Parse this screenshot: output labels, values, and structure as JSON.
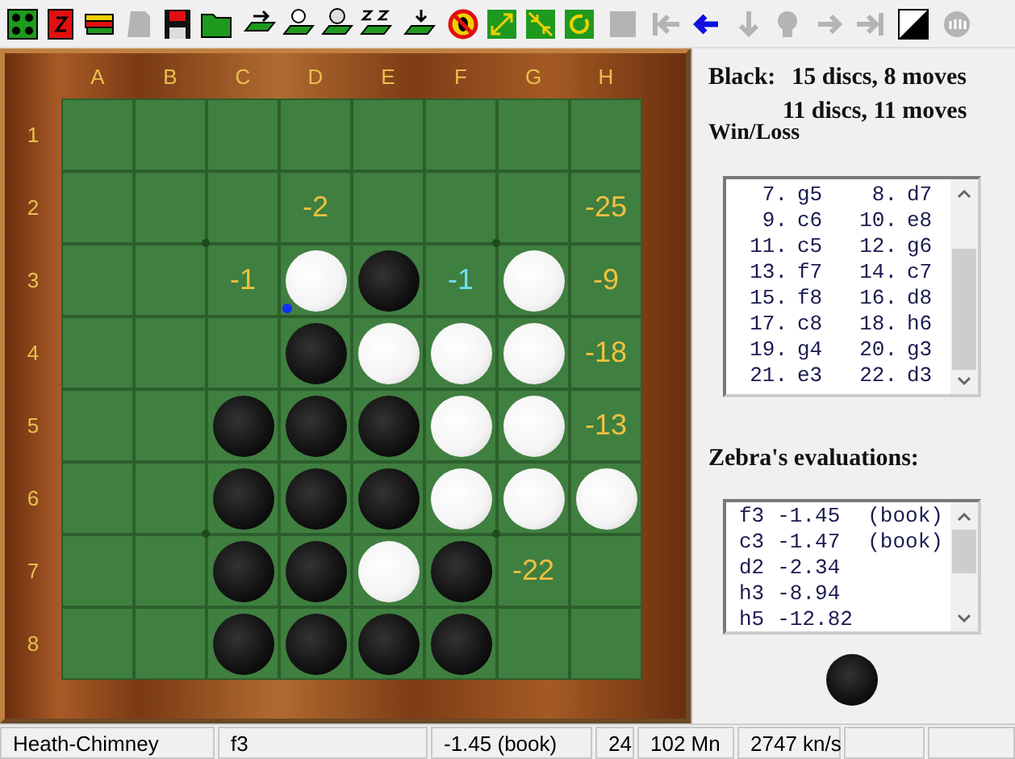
{
  "toolbar": [
    [
      {
        "kind": "dice",
        "disabled": false
      },
      {
        "kind": "book",
        "disabled": false
      },
      {
        "kind": "books",
        "disabled": false
      },
      {
        "kind": "page",
        "disabled": true
      },
      {
        "kind": "floppy",
        "disabled": false
      },
      {
        "kind": "folder",
        "disabled": false
      }
    ],
    [
      {
        "kind": "board-arrow",
        "disabled": false
      },
      {
        "kind": "board-person",
        "disabled": false
      },
      {
        "kind": "board-face",
        "disabled": false
      },
      {
        "kind": "board-zz",
        "disabled": false
      }
    ],
    [
      {
        "kind": "board-down",
        "disabled": false
      }
    ],
    [
      {
        "kind": "no-sign",
        "disabled": false
      },
      {
        "kind": "expand",
        "disabled": false
      },
      {
        "kind": "contract",
        "disabled": false
      },
      {
        "kind": "rotate",
        "disabled": false
      }
    ],
    [
      {
        "kind": "square",
        "disabled": true
      }
    ],
    [
      {
        "kind": "first",
        "disabled": true
      },
      {
        "kind": "back",
        "disabled": false
      }
    ],
    [
      {
        "kind": "down",
        "disabled": true
      },
      {
        "kind": "bulb",
        "disabled": true
      }
    ],
    [
      {
        "kind": "forward",
        "disabled": true
      },
      {
        "kind": "last",
        "disabled": true
      }
    ],
    [
      {
        "kind": "contrast",
        "disabled": false
      }
    ],
    [
      {
        "kind": "stop",
        "disabled": true
      }
    ]
  ],
  "board": {
    "columns": [
      "A",
      "B",
      "C",
      "D",
      "E",
      "F",
      "G",
      "H"
    ],
    "row_labels": [
      "1",
      "2",
      "3",
      "4",
      "5",
      "6",
      "7",
      "8"
    ],
    "rows": [
      [
        {
          "kind": "empty"
        },
        {
          "kind": "empty"
        },
        {
          "kind": "empty"
        },
        {
          "kind": "empty"
        },
        {
          "kind": "empty"
        },
        {
          "kind": "empty"
        },
        {
          "kind": "empty"
        },
        {
          "kind": "empty"
        }
      ],
      [
        {
          "kind": "empty"
        },
        {
          "kind": "empty"
        },
        {
          "kind": "empty"
        },
        {
          "kind": "hint",
          "eval": "-2",
          "best": false
        },
        {
          "kind": "empty"
        },
        {
          "kind": "empty"
        },
        {
          "kind": "empty"
        },
        {
          "kind": "hint",
          "eval": "-25",
          "best": false
        }
      ],
      [
        {
          "kind": "empty"
        },
        {
          "kind": "empty"
        },
        {
          "kind": "hint",
          "eval": "-1",
          "best": false
        },
        {
          "kind": "white",
          "last_move": true
        },
        {
          "kind": "black",
          "last_move": false
        },
        {
          "kind": "hint",
          "eval": "-1",
          "best": true
        },
        {
          "kind": "white",
          "last_move": false
        },
        {
          "kind": "hint",
          "eval": "-9",
          "best": false
        }
      ],
      [
        {
          "kind": "empty"
        },
        {
          "kind": "empty"
        },
        {
          "kind": "empty"
        },
        {
          "kind": "black",
          "last_move": false
        },
        {
          "kind": "white",
          "last_move": false
        },
        {
          "kind": "white",
          "last_move": false
        },
        {
          "kind": "white",
          "last_move": false
        },
        {
          "kind": "hint",
          "eval": "-18",
          "best": false
        }
      ],
      [
        {
          "kind": "empty"
        },
        {
          "kind": "empty"
        },
        {
          "kind": "black",
          "last_move": false
        },
        {
          "kind": "black",
          "last_move": false
        },
        {
          "kind": "black",
          "last_move": false
        },
        {
          "kind": "white",
          "last_move": false
        },
        {
          "kind": "white",
          "last_move": false
        },
        {
          "kind": "hint",
          "eval": "-13",
          "best": false
        }
      ],
      [
        {
          "kind": "empty"
        },
        {
          "kind": "empty"
        },
        {
          "kind": "black",
          "last_move": false
        },
        {
          "kind": "black",
          "last_move": false
        },
        {
          "kind": "black",
          "last_move": false
        },
        {
          "kind": "white",
          "last_move": false
        },
        {
          "kind": "white",
          "last_move": false
        },
        {
          "kind": "white",
          "last_move": false
        }
      ],
      [
        {
          "kind": "empty"
        },
        {
          "kind": "empty"
        },
        {
          "kind": "black",
          "last_move": false
        },
        {
          "kind": "black",
          "last_move": false
        },
        {
          "kind": "white",
          "last_move": false
        },
        {
          "kind": "black",
          "last_move": false
        },
        {
          "kind": "hint",
          "eval": "-22",
          "best": false
        },
        {
          "kind": "empty"
        }
      ],
      [
        {
          "kind": "empty"
        },
        {
          "kind": "empty"
        },
        {
          "kind": "black",
          "last_move": false
        },
        {
          "kind": "black",
          "last_move": false
        },
        {
          "kind": "black",
          "last_move": false
        },
        {
          "kind": "black",
          "last_move": false
        },
        {
          "kind": "empty"
        },
        {
          "kind": "empty"
        }
      ]
    ]
  },
  "panel": {
    "black_label": "Black:",
    "black_value": "15 discs, 8 moves",
    "white_value": "11 discs, 11 moves",
    "win_loss_label": "Win/Loss",
    "moves": [
      [
        "7.",
        "g5",
        "8.",
        "d7"
      ],
      [
        "9.",
        "c6",
        "10.",
        "e8"
      ],
      [
        "11.",
        "c5",
        "12.",
        "g6"
      ],
      [
        "13.",
        "f7",
        "14.",
        "c7"
      ],
      [
        "15.",
        "f8",
        "16.",
        "d8"
      ],
      [
        "17.",
        "c8",
        "18.",
        "h6"
      ],
      [
        "19.",
        "g4",
        "20.",
        "g3"
      ],
      [
        "21.",
        "e3",
        "22.",
        "d3"
      ]
    ],
    "evaluations_label": "Zebra's evaluations:",
    "evaluations": [
      {
        "move": "f3",
        "score": "-1.45",
        "note": "(book)"
      },
      {
        "move": "c3",
        "score": "-1.47",
        "note": "(book)"
      },
      {
        "move": "d2",
        "score": "-2.34"
      },
      {
        "move": "h3",
        "score": "-8.94"
      },
      {
        "move": "h5",
        "score": "-12.82"
      }
    ],
    "turn_disc": {
      "kind": "black"
    }
  },
  "status_bar": [
    "Heath-Chimney",
    "f3",
    "-1.45 (book)",
    "24",
    "102 Mn",
    "2747 kn/s"
  ]
}
